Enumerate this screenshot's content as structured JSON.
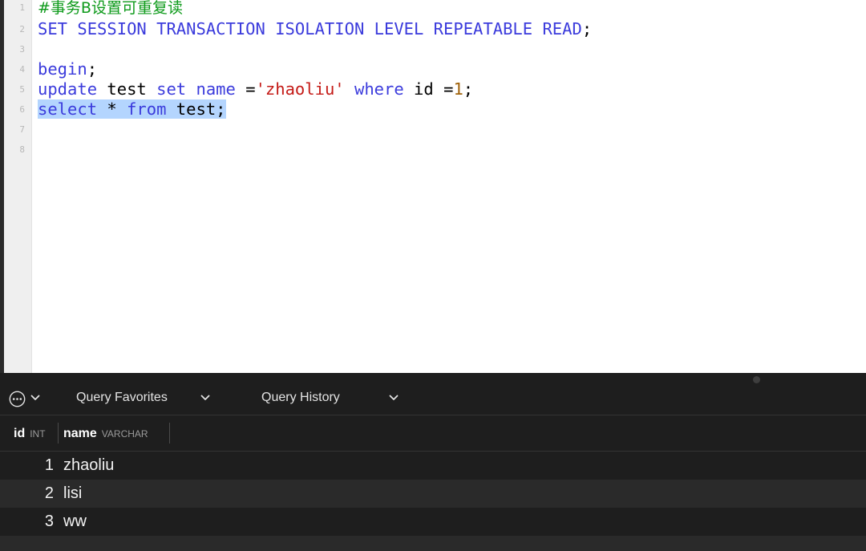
{
  "editor": {
    "line_numbers": [
      "1",
      "2",
      "3",
      "4",
      "5",
      "6",
      "7",
      "8"
    ],
    "lines": {
      "l1": {
        "comment": "#事务B设置可重复读"
      },
      "l2": {
        "kw1": "SET SESSION TRANSACTION ISOLATION LEVEL REPEATABLE READ",
        "p1": ";"
      },
      "l4": {
        "kw1": "begin",
        "p1": ";"
      },
      "l5": {
        "kw1": "update",
        "p1": " test ",
        "kw2": "set",
        "p2": " ",
        "kw3": "name",
        "p3": " =",
        "str": "'zhaoliu'",
        "p4": " ",
        "kw4": "where",
        "p5": " id =",
        "num": "1",
        "p6": ";"
      },
      "l6": {
        "kw1": "select",
        "p1": " * ",
        "kw2": "from",
        "p2": " test;"
      }
    }
  },
  "toolbar": {
    "more_icon": "ellipsis-circle-icon",
    "query_favorites_label": "Query Favorites",
    "query_history_label": "Query History"
  },
  "results": {
    "columns": [
      {
        "name": "id",
        "type": "INT"
      },
      {
        "name": "name",
        "type": "VARCHAR"
      }
    ],
    "rows": [
      {
        "id": "1",
        "name": "zhaoliu"
      },
      {
        "id": "2",
        "name": "lisi"
      },
      {
        "id": "3",
        "name": "ww"
      }
    ]
  },
  "colors": {
    "keyword": "#3b3bdc",
    "string": "#c41a16",
    "number": "#a0620a",
    "comment": "#0d9a1a",
    "selection": "#b4d5fe"
  }
}
